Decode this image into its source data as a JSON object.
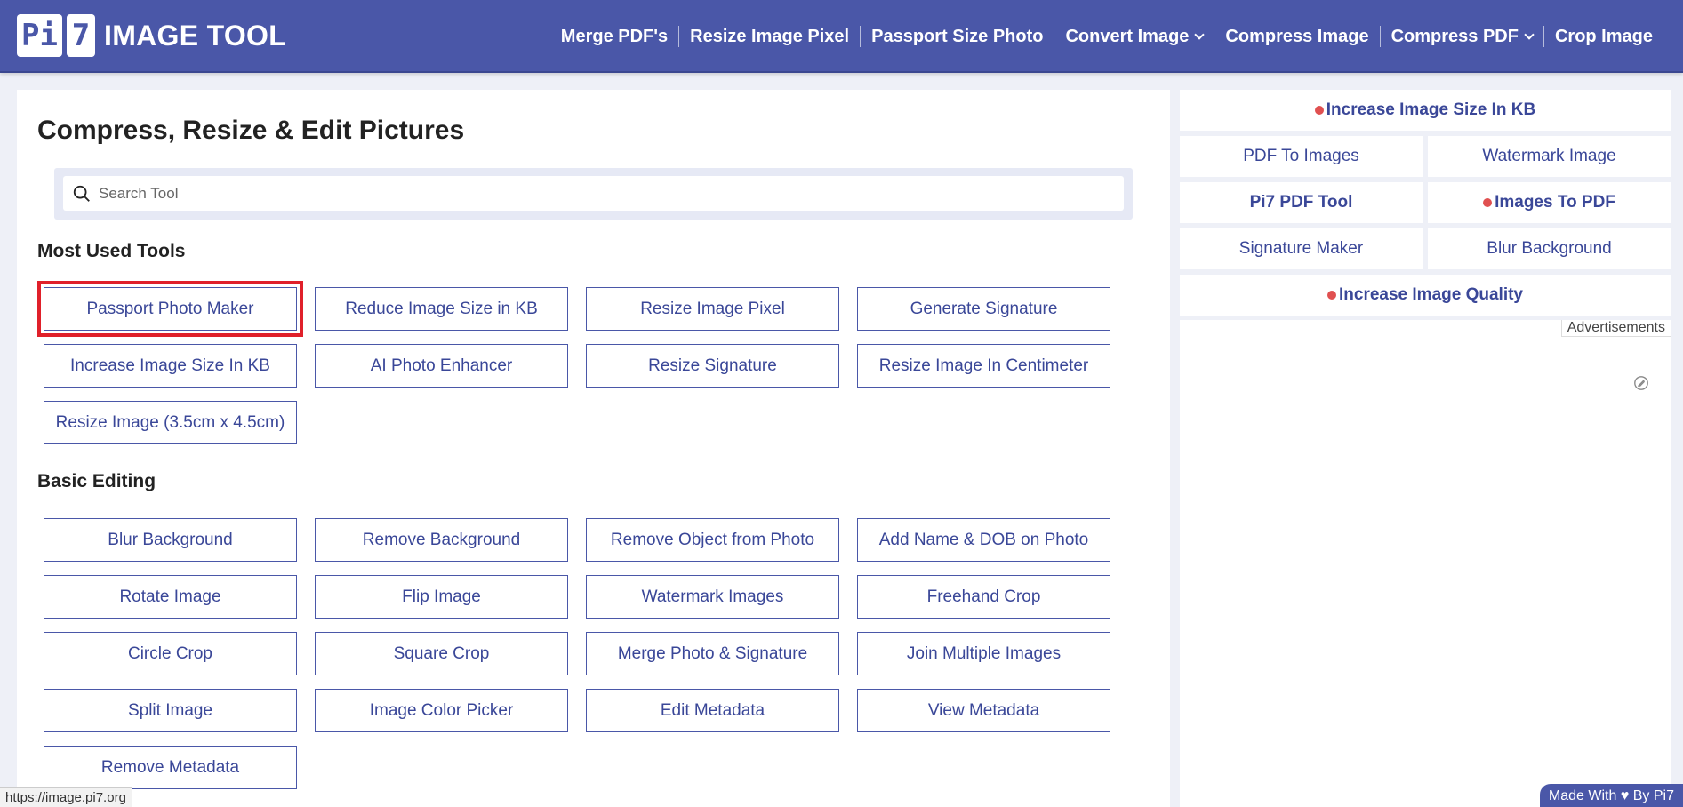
{
  "header": {
    "logo_part1": "Pi",
    "logo_part2": "7",
    "logo_text": "IMAGE TOOL",
    "nav": [
      {
        "label": "Merge PDF's"
      },
      {
        "label": "Resize Image Pixel"
      },
      {
        "label": "Passport Size Photo"
      },
      {
        "label": "Convert Image",
        "dropdown": true
      },
      {
        "label": "Compress Image"
      },
      {
        "label": "Compress PDF",
        "dropdown": true
      },
      {
        "label": "Crop Image"
      }
    ]
  },
  "main": {
    "title": "Compress, Resize & Edit Pictures",
    "search_placeholder": "Search Tool",
    "most_used_title": "Most Used Tools",
    "most_used": [
      "Passport Photo Maker",
      "Reduce Image Size in KB",
      "Resize Image Pixel",
      "Generate Signature",
      "Increase Image Size In KB",
      "AI Photo Enhancer",
      "Resize Signature",
      "Resize Image In Centimeter",
      "Resize Image (3.5cm x 4.5cm)"
    ],
    "basic_editing_title": "Basic Editing",
    "basic_editing": [
      "Blur Background",
      "Remove Background",
      "Remove Object from Photo",
      "Add Name & DOB on Photo",
      "Rotate Image",
      "Flip Image",
      "Watermark Images",
      "Freehand Crop",
      "Circle Crop",
      "Square Crop",
      "Merge Photo & Signature",
      "Join Multiple Images",
      "Split Image",
      "Image Color Picker",
      "Edit Metadata",
      "View Metadata",
      "Remove Metadata"
    ]
  },
  "sidebar": {
    "top": "Increase Image Size In KB",
    "row1": [
      "PDF To Images",
      "Watermark Image"
    ],
    "row2": [
      "Pi7 PDF Tool",
      "Images To PDF"
    ],
    "row3": [
      "Signature Maker",
      "Blur Background"
    ],
    "bottom": "Increase Image Quality",
    "ad_label": "Advertisements"
  },
  "footer": {
    "made_with": "Made With ♥ By  Pi7",
    "status_url": "https://image.pi7.org"
  },
  "colors": {
    "brand": "#4a57a8",
    "highlight": "#e0202a",
    "dot": "#e05050"
  }
}
